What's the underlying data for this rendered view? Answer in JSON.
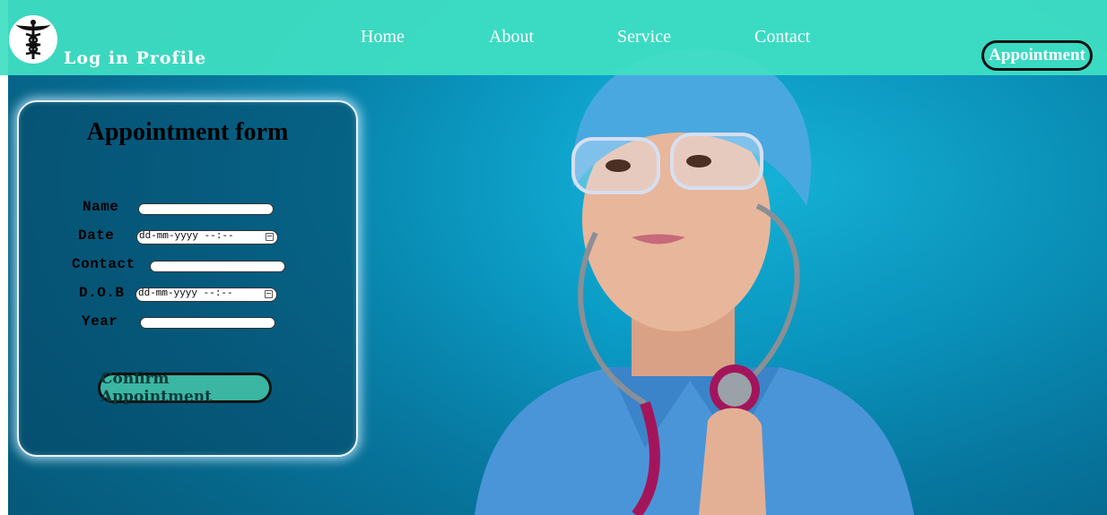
{
  "navbar": {
    "brand": "Log in Profile",
    "links": [
      "Home",
      "About",
      "Service",
      "Contact"
    ],
    "appointment_button": "Appointment",
    "logo_icon": "caduceus-icon"
  },
  "form": {
    "title": "Appointment form",
    "fields": [
      {
        "label": "Name",
        "type": "text",
        "value": ""
      },
      {
        "label": "Date",
        "type": "datetime",
        "placeholder": "dd-mm-yyyy --:--"
      },
      {
        "label": "Contact",
        "type": "text",
        "value": ""
      },
      {
        "label": "D.O.B",
        "type": "datetime",
        "placeholder": "dd-mm-yyyy --:--"
      },
      {
        "label": "Year",
        "type": "text",
        "value": ""
      }
    ],
    "submit": "Confirm Appointment"
  },
  "colors": {
    "navbar": "#40e0c3",
    "background": "#0a9cc6"
  }
}
